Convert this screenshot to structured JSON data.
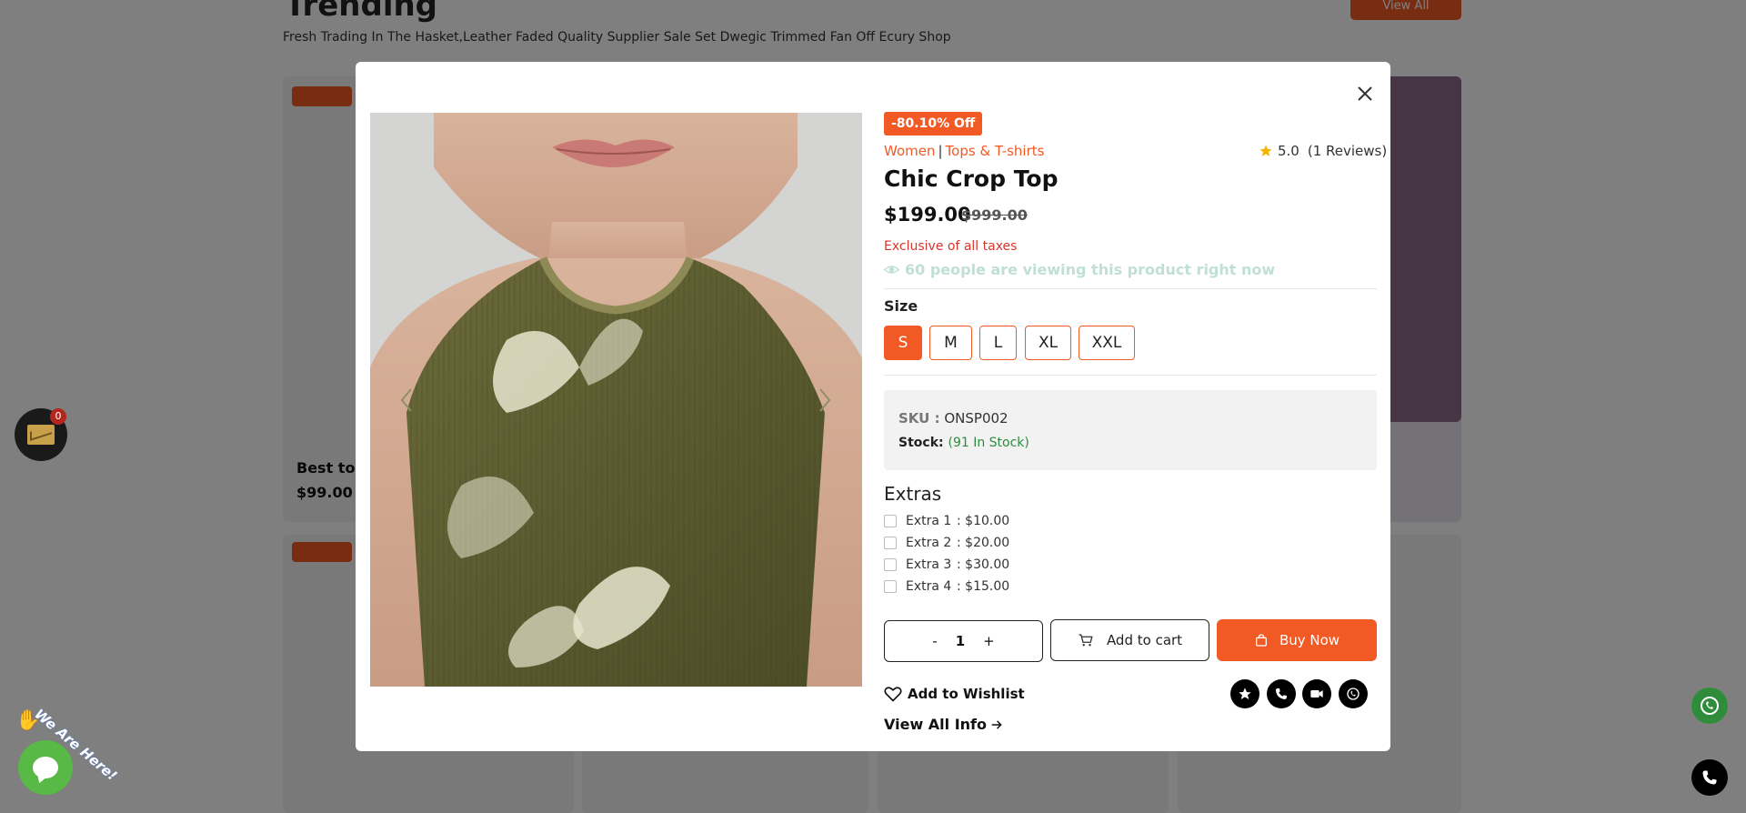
{
  "background": {
    "heading": "Trending",
    "subtitle": "Fresh Trading In The Hasket,Leather Faded Quality Supplier Sale Set Dwegic Trimmed Fan Off Ecury Shop",
    "button_label": "View All",
    "card_title": "Best top",
    "card_price": "$99.00"
  },
  "widgets": {
    "mail_count": "0",
    "chat_caption": "We Are Here!"
  },
  "product": {
    "discount": "-80.10% Off",
    "category_primary": "Women",
    "category_secondary": "Tops & T-shirts",
    "category_separator": "|",
    "rating_value": "5.0",
    "review_count": "(1 Reviews)",
    "title": "Chic Crop Top",
    "price": "$199.00",
    "old_price": "$999.00",
    "tax_note": "Exclusive of all taxes",
    "viewing_note": "60 people are viewing this product right now",
    "size_label": "Size",
    "sizes": [
      {
        "label": "S",
        "active": true
      },
      {
        "label": "M",
        "active": false
      },
      {
        "label": "L",
        "active": false
      },
      {
        "label": "XL",
        "active": false
      },
      {
        "label": "XXL",
        "active": false
      }
    ],
    "sku_label": "SKU :",
    "sku_value": "ONSP002",
    "stock_label": "Stock:",
    "stock_value": "(91 In Stock)",
    "extras_title": "Extras",
    "extras": [
      {
        "name": "Extra 1",
        "price": ": $10.00"
      },
      {
        "name": "Extra 2",
        "price": ": $20.00"
      },
      {
        "name": "Extra 3",
        "price": ": $30.00"
      },
      {
        "name": "Extra 4",
        "price": ": $15.00"
      }
    ],
    "qty_minus": "-",
    "qty_value": "1",
    "qty_plus": "+",
    "add_to_cart_label": "Add to cart",
    "buy_now_label": "Buy Now",
    "wishlist_label": "Add to Wishlist",
    "view_all_label": "View All Info",
    "share_icons": [
      "star-icon",
      "phone-icon",
      "video-icon",
      "whatsapp-icon"
    ]
  },
  "colors": {
    "accent": "#f15a24",
    "stock_green": "#2e8b3f",
    "tax_red": "#d9362b"
  }
}
